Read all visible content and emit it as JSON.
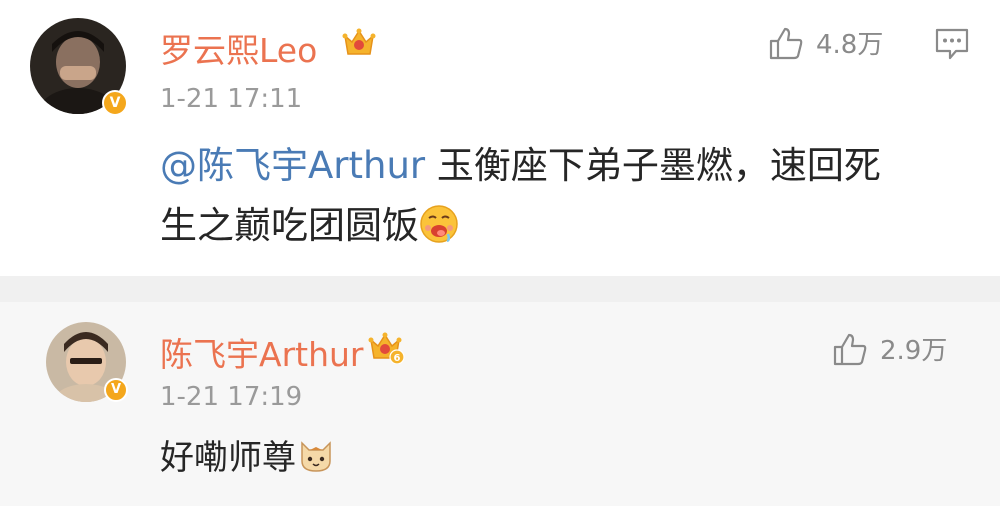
{
  "comment": {
    "username": "罗云熙Leo",
    "timestamp": "1-21 17:11",
    "like_count": "4.8万",
    "mention": "@陈飞宇Arthur",
    "text_line1": " 玉衡座下弟子墨燃，速回死",
    "text_line2": "生之巅吃团圆饭",
    "emoji": "drooling-face-emoji",
    "verified_badge": "V",
    "vip_level": ""
  },
  "reply": {
    "username": "陈飞宇Arthur",
    "timestamp": "1-21 17:19",
    "like_count": "2.9万",
    "text": "好嘞师尊",
    "emoji": "cat-face-emoji",
    "verified_badge": "V",
    "vip_level": "6"
  },
  "colors": {
    "username": "#eb7350",
    "mention": "#4a7bb5",
    "badge": "#f4a71c",
    "meta": "#9a9a9a"
  }
}
